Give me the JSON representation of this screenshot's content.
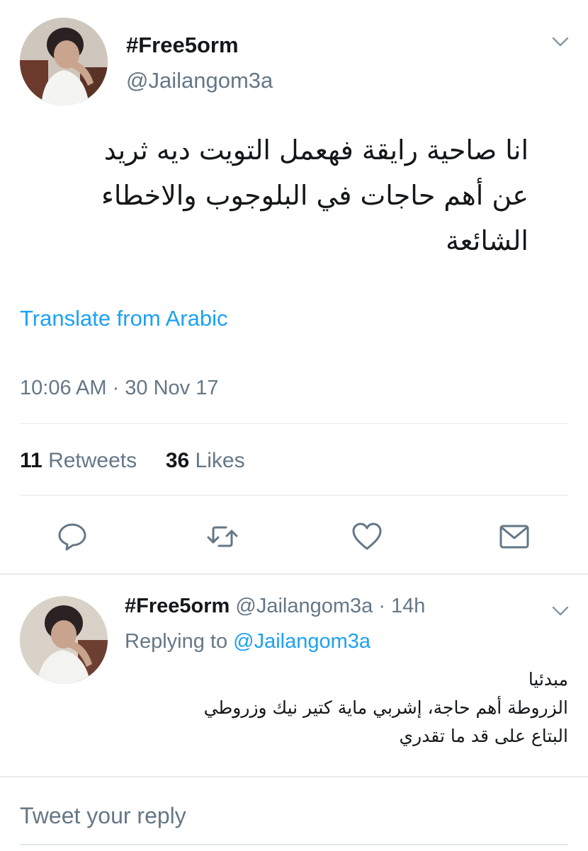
{
  "tweet": {
    "display_name": "#Free5orm",
    "handle": "@Jailangom3a",
    "text_lines": [
      "انا صاحية رايقة فهعمل التويت ديه ثريد",
      "عن أهم حاجات في البلوجوب والاخطاء",
      "الشائعة"
    ],
    "translate_label": "Translate from Arabic",
    "timestamp": "10:06 AM · 30 Nov 17",
    "retweets_count": "11",
    "retweets_label": "Retweets",
    "likes_count": "36",
    "likes_label": "Likes"
  },
  "reply": {
    "display_name": "#Free5orm",
    "handle": "@Jailangom3a",
    "time": "· 14h",
    "replying_prefix": "Replying to",
    "replying_handle": "@Jailangom3a",
    "text_lines": [
      "مبدئيا",
      "الزروطة أهم حاجة، إشربي ماية كتير نيك وزروطي",
      "البتاع على قد ما تقدري"
    ]
  },
  "compose": {
    "placeholder": "Tweet your reply"
  },
  "icons": {
    "reply": "reply-icon",
    "retweet": "retweet-icon",
    "like": "heart-icon",
    "share": "envelope-icon",
    "menu": "chevron-down-icon"
  },
  "colors": {
    "accent": "#1da1f2",
    "secondary_text": "#657786",
    "primary_text": "#14171a",
    "divider": "#e1e8ed"
  }
}
